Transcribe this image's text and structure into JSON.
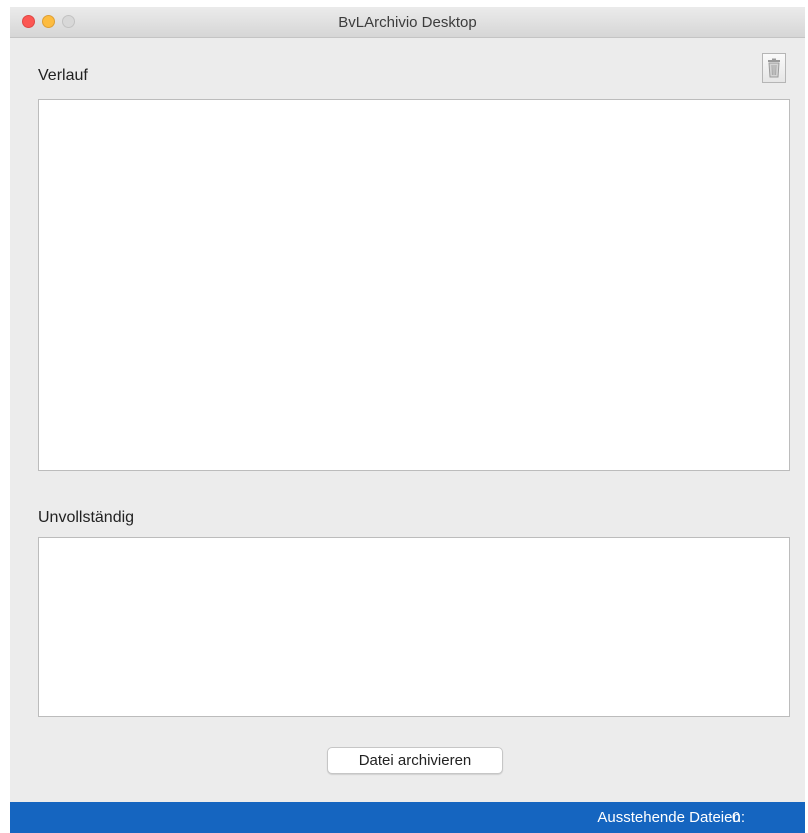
{
  "window": {
    "title": "BvLArchivio Desktop"
  },
  "toolbar": {
    "trash_icon": "trash-icon"
  },
  "sections": {
    "verlauf_label": "Verlauf",
    "unvollstaendig_label": "Unvollständig"
  },
  "actions": {
    "archive_label": "Datei archivieren"
  },
  "status": {
    "pending_label": "Ausstehende Dateien:",
    "pending_count": "0",
    "bar_color": "#1565c0"
  }
}
